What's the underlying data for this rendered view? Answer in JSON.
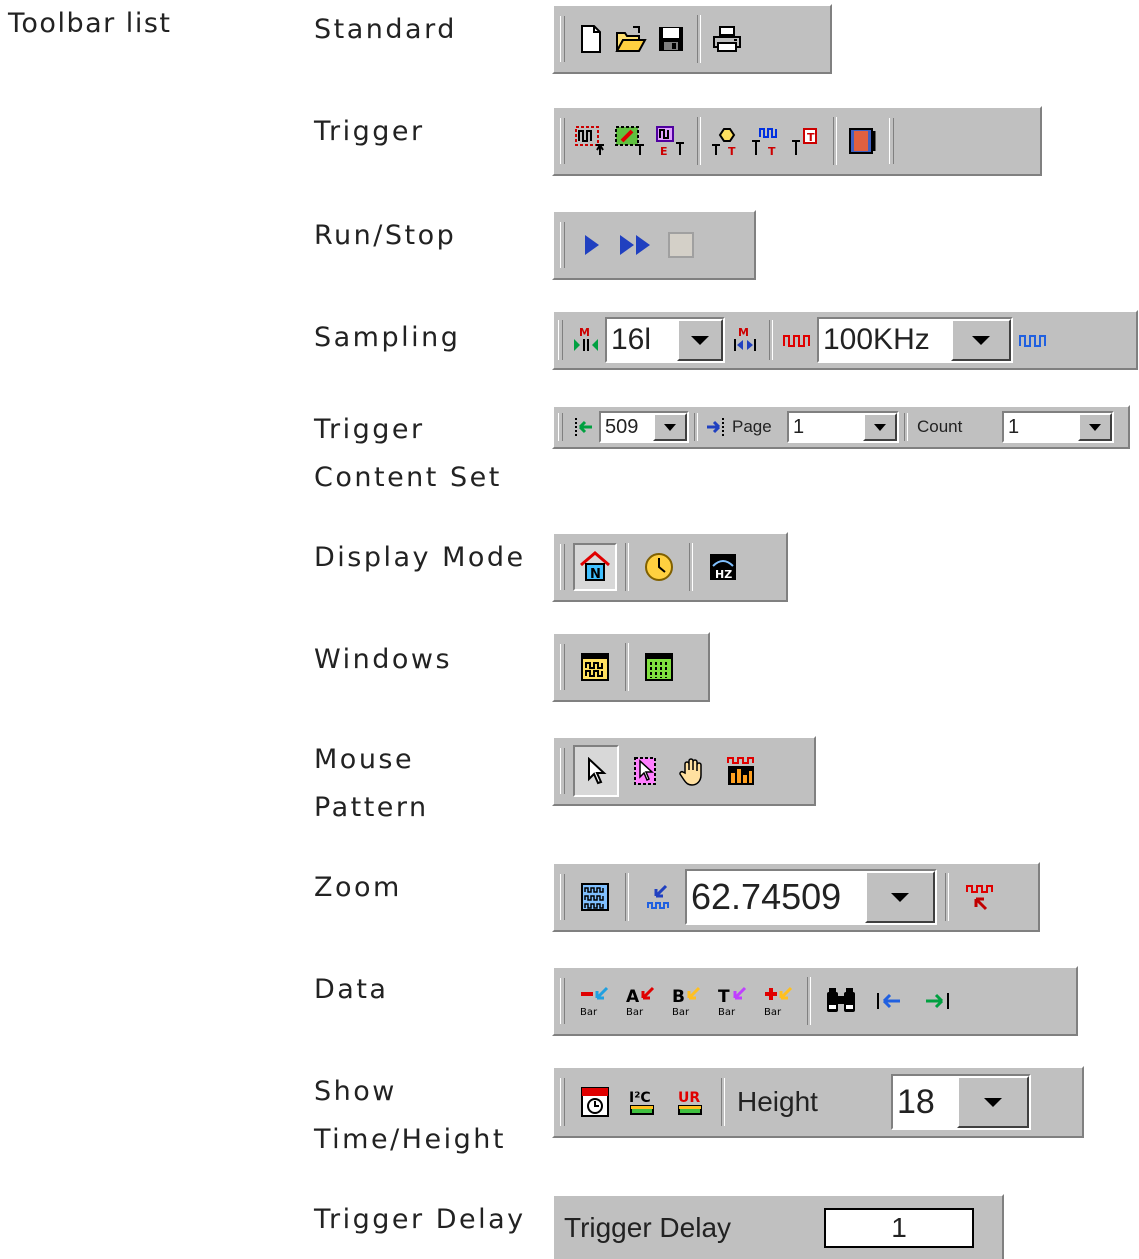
{
  "heading": "Toolbar list",
  "labels": {
    "standard": "Standard",
    "trigger": "Trigger",
    "run_stop": "Run/Stop",
    "sampling": "Sampling",
    "trigger_content_set_1": "Trigger",
    "trigger_content_set_2": "Content Set",
    "display_mode": "Display Mode",
    "windows": "Windows",
    "mouse_pattern_1": "Mouse",
    "mouse_pattern_2": "Pattern",
    "zoom": "Zoom",
    "data": "Data",
    "show_time_height_1": "Show",
    "show_time_height_2": "Time/Height",
    "trigger_delay": "Trigger Delay"
  },
  "sampling": {
    "depth_value": "16l",
    "rate_value": "100KHz"
  },
  "content_set": {
    "position_value": "509",
    "page_label": "Page",
    "page_value": "1",
    "count_label": "Count",
    "count_value": "1"
  },
  "zoom": {
    "value": "62.74509"
  },
  "show": {
    "height_label": "Height",
    "height_value": "18",
    "i2c_text": "I²C",
    "uart_text": "UR"
  },
  "data_bars": {
    "bar_text": "Bar",
    "a": "A",
    "b": "B",
    "t": "T"
  },
  "display_icons": {
    "n_text": "N",
    "hz_text": "HZ"
  },
  "trigger_delay": {
    "label": "Trigger Delay",
    "value": "1"
  },
  "sampling_icons": {
    "m_text": "M"
  },
  "trigger_icons": {
    "e_text": "E",
    "t_text": "T"
  },
  "icons": [
    "new-file-icon",
    "open-folder-icon",
    "save-disk-icon",
    "printer-icon",
    "play-icon",
    "fast-forward-icon",
    "stop-icon",
    "binoculars-icon"
  ],
  "colors": {
    "toolbar_bg": "#c0c0c0",
    "play_blue": "#2040c0",
    "accent_red": "#e00000"
  }
}
